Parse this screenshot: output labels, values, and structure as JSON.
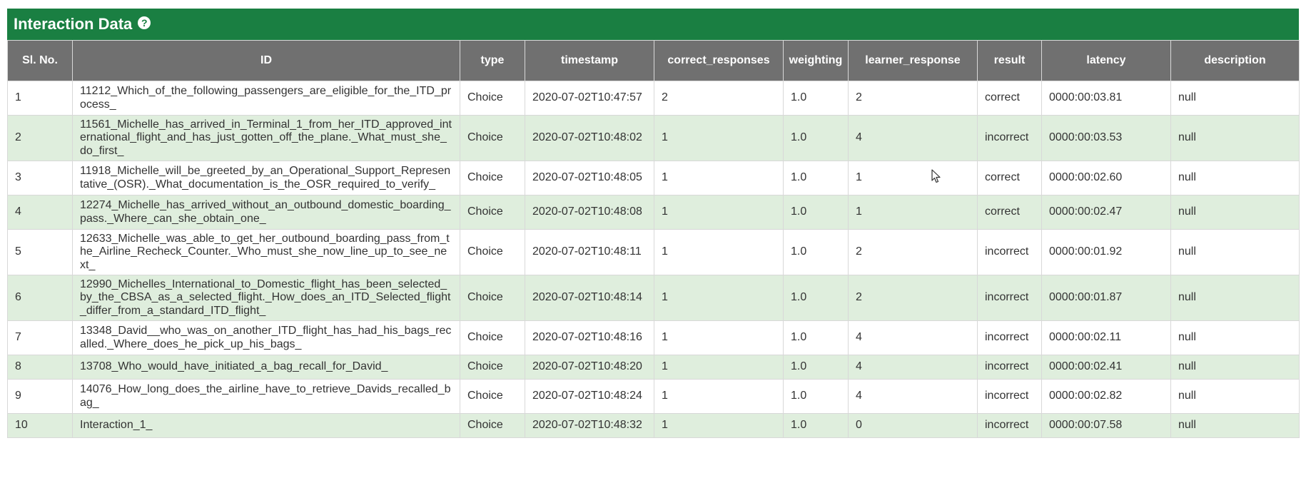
{
  "panel": {
    "title": "Interaction Data",
    "help_icon": "question-circle-icon"
  },
  "columns": [
    "Sl. No.",
    "ID",
    "type",
    "timestamp",
    "correct_responses",
    "weighting",
    "learner_response",
    "result",
    "latency",
    "description"
  ],
  "rows": [
    {
      "sl": "1",
      "id": "11212_Which_of_the_following_passengers_are_eligible_for_the_ITD_process_",
      "type": "Choice",
      "timestamp": "2020-07-02T10:47:57",
      "correct_responses": "2",
      "weighting": "1.0",
      "learner_response": "2",
      "result": "correct",
      "latency": "0000:00:03.81",
      "description": "null"
    },
    {
      "sl": "2",
      "id": "11561_Michelle_has_arrived_in_Terminal_1_from_her_ITD_approved_international_flight_and_has_just_gotten_off_the_plane._What_must_she_do_first_",
      "type": "Choice",
      "timestamp": "2020-07-02T10:48:02",
      "correct_responses": "1",
      "weighting": "1.0",
      "learner_response": "4",
      "result": "incorrect",
      "latency": "0000:00:03.53",
      "description": "null"
    },
    {
      "sl": "3",
      "id": "11918_Michelle_will_be_greeted_by_an_Operational_Support_Representative_(OSR)._What_documentation_is_the_OSR_required_to_verify_",
      "type": "Choice",
      "timestamp": "2020-07-02T10:48:05",
      "correct_responses": "1",
      "weighting": "1.0",
      "learner_response": "1",
      "result": "correct",
      "latency": "0000:00:02.60",
      "description": "null"
    },
    {
      "sl": "4",
      "id": "12274_Michelle_has_arrived_without_an_outbound_domestic_boarding_pass._Where_can_she_obtain_one_",
      "type": "Choice",
      "timestamp": "2020-07-02T10:48:08",
      "correct_responses": "1",
      "weighting": "1.0",
      "learner_response": "1",
      "result": "correct",
      "latency": "0000:00:02.47",
      "description": "null"
    },
    {
      "sl": "5",
      "id": "12633_Michelle_was_able_to_get_her_outbound_boarding_pass_from_the_Airline_Recheck_Counter._Who_must_she_now_line_up_to_see_next_",
      "type": "Choice",
      "timestamp": "2020-07-02T10:48:11",
      "correct_responses": "1",
      "weighting": "1.0",
      "learner_response": "2",
      "result": "incorrect",
      "latency": "0000:00:01.92",
      "description": "null"
    },
    {
      "sl": "6",
      "id": "12990_Michelles_International_to_Domestic_flight_has_been_selected_by_the_CBSA_as_a_selected_flight._How_does_an_ITD_Selected_flight_differ_from_a_standard_ITD_flight_",
      "type": "Choice",
      "timestamp": "2020-07-02T10:48:14",
      "correct_responses": "1",
      "weighting": "1.0",
      "learner_response": "2",
      "result": "incorrect",
      "latency": "0000:00:01.87",
      "description": "null"
    },
    {
      "sl": "7",
      "id": "13348_David__who_was_on_another_ITD_flight_has_had_his_bags_recalled._Where_does_he_pick_up_his_bags_",
      "type": "Choice",
      "timestamp": "2020-07-02T10:48:16",
      "correct_responses": "1",
      "weighting": "1.0",
      "learner_response": "4",
      "result": "incorrect",
      "latency": "0000:00:02.11",
      "description": "null"
    },
    {
      "sl": "8",
      "id": "13708_Who_would_have_initiated_a_bag_recall_for_David_",
      "type": "Choice",
      "timestamp": "2020-07-02T10:48:20",
      "correct_responses": "1",
      "weighting": "1.0",
      "learner_response": "4",
      "result": "incorrect",
      "latency": "0000:00:02.41",
      "description": "null"
    },
    {
      "sl": "9",
      "id": "14076_How_long_does_the_airline_have_to_retrieve_Davids_recalled_bag_",
      "type": "Choice",
      "timestamp": "2020-07-02T10:48:24",
      "correct_responses": "1",
      "weighting": "1.0",
      "learner_response": "4",
      "result": "incorrect",
      "latency": "0000:00:02.82",
      "description": "null"
    },
    {
      "sl": "10",
      "id": "Interaction_1_",
      "type": "Choice",
      "timestamp": "2020-07-02T10:48:32",
      "correct_responses": "1",
      "weighting": "1.0",
      "learner_response": "0",
      "result": "incorrect",
      "latency": "0000:00:07.58",
      "description": "null"
    }
  ],
  "colors": {
    "header_bar": "#1a7f42",
    "column_header": "#707070",
    "row_alt": "#dfeedd"
  }
}
